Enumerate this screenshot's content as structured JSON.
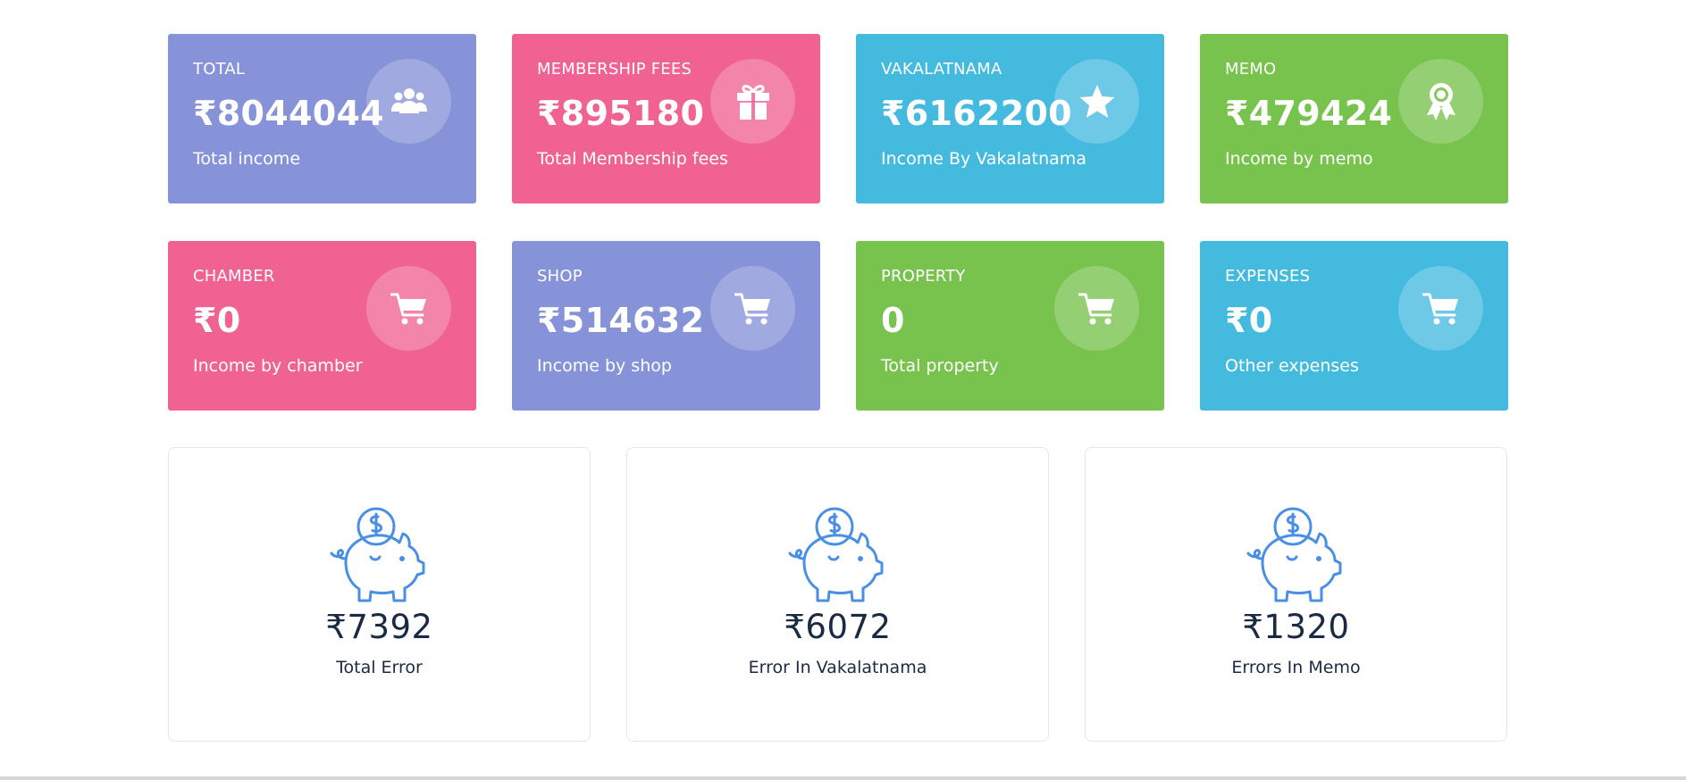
{
  "colors": {
    "purple": "#8793d8",
    "pink": "#f06292",
    "blue": "#45badf",
    "green": "#78c24e",
    "error_text": "#1b2a44",
    "piggy_stroke": "#4a8fe6"
  },
  "stat_cards": [
    {
      "title": "TOTAL",
      "value": "₹8044044",
      "desc": "Total income",
      "icon": "users-icon",
      "color": "purple"
    },
    {
      "title": "MEMBERSHIP FEES",
      "value": "₹895180",
      "desc": "Total Membership fees",
      "icon": "gift-icon",
      "color": "pink"
    },
    {
      "title": "VAKALATNAMA",
      "value": "₹6162200",
      "desc": "Income By Vakalatnama",
      "icon": "star-icon",
      "color": "blue"
    },
    {
      "title": "MEMO",
      "value": "₹479424",
      "desc": "Income by memo",
      "icon": "award-ribbon-icon",
      "color": "green"
    },
    {
      "title": "CHAMBER",
      "value": "₹0",
      "desc": "Income by chamber",
      "icon": "cart-icon",
      "color": "pink"
    },
    {
      "title": "SHOP",
      "value": "₹514632",
      "desc": "Income by shop",
      "icon": "cart-icon",
      "color": "purple"
    },
    {
      "title": "PROPERTY",
      "value": "0",
      "desc": "Total property",
      "icon": "cart-icon",
      "color": "green"
    },
    {
      "title": "EXPENSES",
      "value": "₹0",
      "desc": "Other expenses",
      "icon": "cart-icon",
      "color": "blue"
    }
  ],
  "error_cards": [
    {
      "value": "₹7392",
      "label": "Total Error",
      "icon": "piggy-bank-icon"
    },
    {
      "value": "₹6072",
      "label": "Error In Vakalatnama",
      "icon": "piggy-bank-icon"
    },
    {
      "value": "₹1320",
      "label": "Errors In Memo",
      "icon": "piggy-bank-icon"
    }
  ]
}
